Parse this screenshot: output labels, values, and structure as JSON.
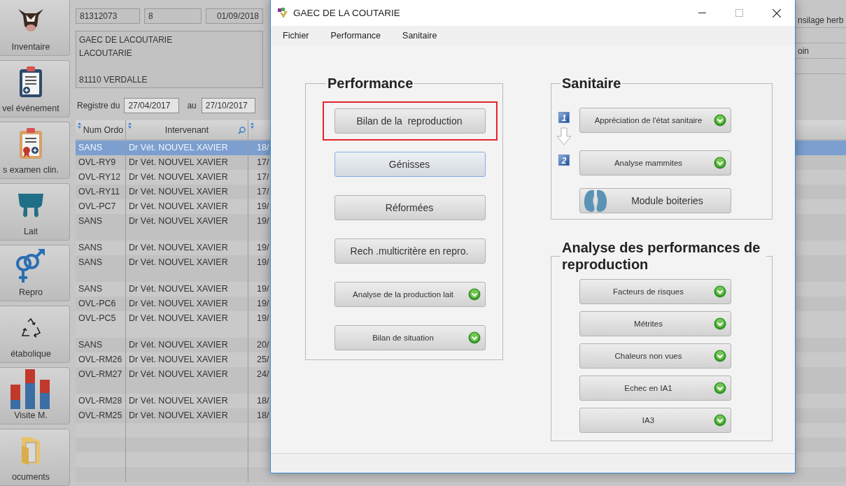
{
  "sidebar": [
    {
      "label": "Inventaire"
    },
    {
      "label": "vel événement"
    },
    {
      "label": "s examen clin."
    },
    {
      "label": "Lait"
    },
    {
      "label": "Repro"
    },
    {
      "label": "étabolique"
    },
    {
      "label": "Visite M."
    },
    {
      "label": "ocuments"
    }
  ],
  "farm": {
    "fields": [
      "81312073",
      "8",
      "01/09/2018"
    ],
    "address": {
      "name": "GAEC DE LACOUTARIE",
      "place": "LACOUTARIE",
      "city": "81110 VERDALLE"
    },
    "register": {
      "label": "Registre du",
      "from": "27/04/2017",
      "to_label": "au",
      "to": "27/10/2017"
    }
  },
  "right_panel": {
    "lines": [
      "nsilage herb",
      "oin"
    ]
  },
  "table": {
    "columns": [
      "Num Ordo",
      "Intervenant"
    ],
    "rows": [
      {
        "num_ordo": "SANS",
        "intervenant": "Dr Vét. NOUVEL XAVIER",
        "column_3": "18/",
        "selected": true,
        "tall": false
      },
      {
        "num_ordo": "OVL-RY9",
        "intervenant": "Dr Vét. NOUVEL XAVIER",
        "column_3": "17/",
        "selected": false,
        "tall": false
      },
      {
        "num_ordo": "OVL-RY12",
        "intervenant": "Dr Vét. NOUVEL XAVIER",
        "column_3": "17/",
        "selected": false,
        "tall": false
      },
      {
        "num_ordo": "OVL-RY11",
        "intervenant": "Dr Vét. NOUVEL XAVIER",
        "column_3": "17/",
        "selected": false,
        "tall": false
      },
      {
        "num_ordo": "OVL-PC7",
        "intervenant": "Dr Vét. NOUVEL XAVIER",
        "column_3": "19/",
        "selected": false,
        "tall": false
      },
      {
        "num_ordo": "SANS",
        "intervenant": "Dr Vét. NOUVEL XAVIER",
        "column_3": "19/",
        "selected": false,
        "tall": true
      },
      {
        "num_ordo": "SANS",
        "intervenant": "Dr Vét. NOUVEL XAVIER",
        "column_3": "19/",
        "selected": false,
        "tall": false
      },
      {
        "num_ordo": "SANS",
        "intervenant": "Dr Vét. NOUVEL XAVIER",
        "column_3": "19/",
        "selected": false,
        "tall": true
      },
      {
        "num_ordo": "SANS",
        "intervenant": "Dr Vét. NOUVEL XAVIER",
        "column_3": "19/",
        "selected": false,
        "tall": false
      },
      {
        "num_ordo": "OVL-PC6",
        "intervenant": "Dr Vét. NOUVEL XAVIER",
        "column_3": "19/",
        "selected": false,
        "tall": false
      },
      {
        "num_ordo": "OVL-PC5",
        "intervenant": "Dr Vét. NOUVEL XAVIER",
        "column_3": "19/",
        "selected": false,
        "tall": true
      },
      {
        "num_ordo": "SANS",
        "intervenant": "Dr Vét. NOUVEL XAVIER",
        "column_3": "20/",
        "selected": false,
        "tall": false
      },
      {
        "num_ordo": "OVL-RM26",
        "intervenant": "Dr Vét. NOUVEL XAVIER",
        "column_3": "25/",
        "selected": false,
        "tall": false
      },
      {
        "num_ordo": "OVL-RM27",
        "intervenant": "Dr Vét. NOUVEL XAVIER",
        "column_3": "24/",
        "selected": false,
        "tall": true
      },
      {
        "num_ordo": "OVL-RM28",
        "intervenant": "Dr Vét. NOUVEL XAVIER",
        "column_3": "18/",
        "selected": false,
        "tall": false
      },
      {
        "num_ordo": "OVL-RM25",
        "intervenant": "Dr Vét. NOUVEL XAVIER",
        "column_3": "18/",
        "selected": false,
        "tall": false
      }
    ]
  },
  "dialog": {
    "title": "GAEC DE LA COUTARIE",
    "menu": [
      {
        "label": "Fichier"
      },
      {
        "label": "Performance"
      },
      {
        "label": "Sanitaire"
      }
    ],
    "groups": [
      {
        "title": "Performance",
        "buttons": [
          {
            "label": "Bilan de la  reproduction",
            "highlighted": true,
            "focused": false,
            "has_menu": false
          },
          {
            "label": "Génisses",
            "highlighted": false,
            "focused": true,
            "has_menu": false
          },
          {
            "label": "Réformées",
            "highlighted": false,
            "focused": false,
            "has_menu": false
          },
          {
            "label": "Rech .multicritère en repro.",
            "highlighted": false,
            "focused": false,
            "has_menu": false
          },
          {
            "label": "Analyse de la production lait",
            "highlighted": false,
            "focused": false,
            "has_menu": true
          },
          {
            "label": "Bilan de situation",
            "highlighted": false,
            "focused": false,
            "has_menu": true
          }
        ]
      },
      {
        "title": "Sanitaire",
        "buttons": [
          {
            "label": "Appréciation de l'état sanitaire",
            "step": "1",
            "kind": "text",
            "highlighted": false,
            "focused": false,
            "has_menu": true
          },
          {
            "label": "Analyse mammites",
            "step": "2",
            "kind": "text",
            "highlighted": false,
            "focused": false,
            "has_menu": true
          },
          {
            "label": "Module boiteries",
            "kind": "image",
            "highlighted": false,
            "focused": false,
            "has_menu": false
          }
        ]
      },
      {
        "title": "Analyse des performances de reproduction",
        "buttons": [
          {
            "label": "Facteurs de risques",
            "highlighted": false,
            "focused": false,
            "has_menu": true
          },
          {
            "label": "Métrites",
            "highlighted": false,
            "focused": false,
            "has_menu": true
          },
          {
            "label": "Chaleurs non vues",
            "highlighted": false,
            "focused": false,
            "has_menu": true
          },
          {
            "label": "Echec en IA1",
            "highlighted": false,
            "focused": false,
            "has_menu": true
          },
          {
            "label": "IA3",
            "highlighted": false,
            "focused": false,
            "has_menu": true
          }
        ]
      }
    ]
  }
}
